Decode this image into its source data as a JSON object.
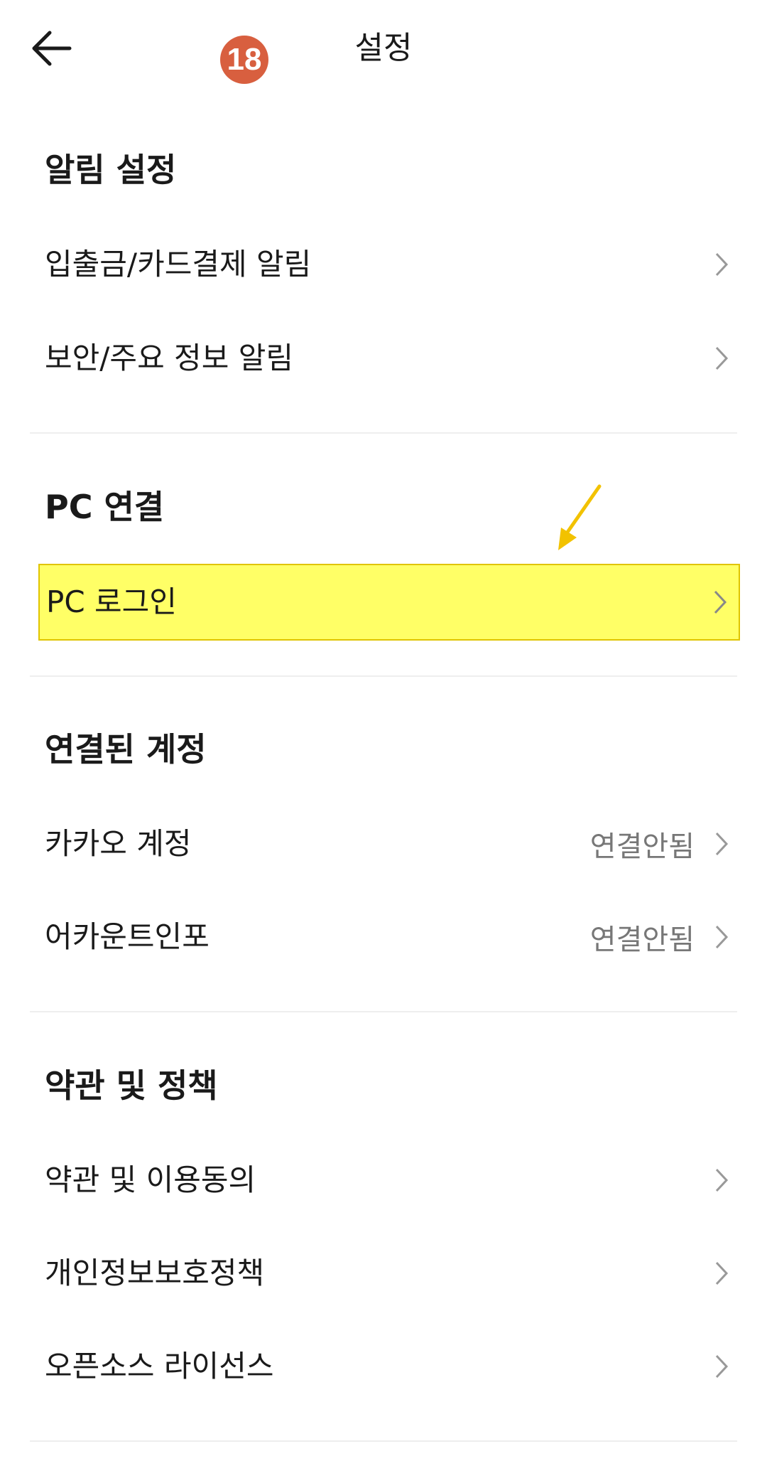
{
  "header": {
    "back_icon": "arrow-left-icon",
    "step_badge": "18",
    "title": "설정"
  },
  "sections": [
    {
      "title": "알림 설정",
      "items": [
        {
          "label": "입출금/카드결제 알림"
        },
        {
          "label": "보안/주요 정보 알림"
        }
      ]
    },
    {
      "title": "PC 연결",
      "items": [
        {
          "label": "PC 로그인",
          "highlighted": true
        }
      ]
    },
    {
      "title": "연결된 계정",
      "items": [
        {
          "label": "카카오 계정",
          "value": "연결안됨"
        },
        {
          "label": "어카운트인포",
          "value": "연결안됨"
        }
      ]
    },
    {
      "title": "약관 및 정책",
      "items": [
        {
          "label": "약관 및 이용동의"
        },
        {
          "label": "개인정보보호정책"
        },
        {
          "label": "오픈소스 라이선스"
        }
      ]
    }
  ],
  "colors": {
    "highlight": "#ffff66",
    "badge": "#d85f3f",
    "annotation_arrow": "#f2c200",
    "divider": "#eeeeee"
  },
  "icons": {
    "chevron": "chevron-right-icon",
    "annotation": "annotation-arrow-icon"
  }
}
